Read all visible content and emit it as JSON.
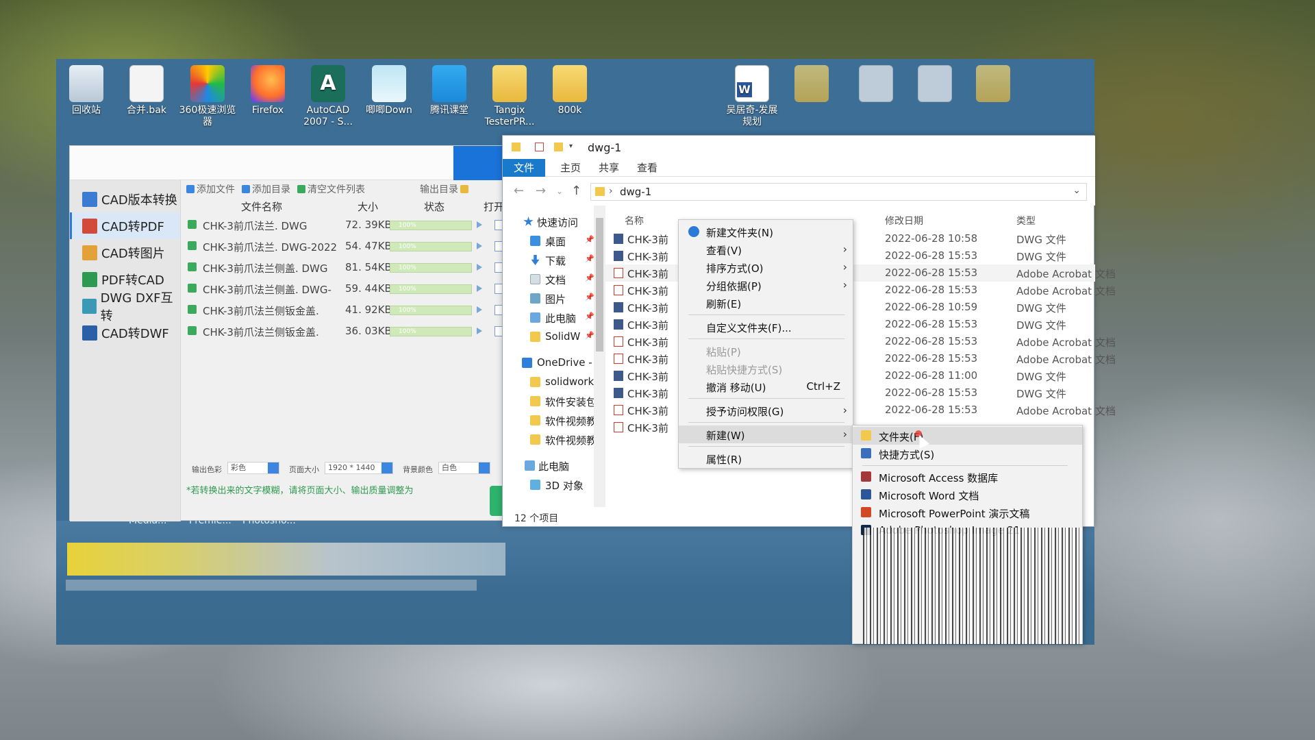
{
  "colors": {
    "desktop_blue": "#3d6e96",
    "explorer_file_tab": "#1979ca",
    "cad_active_blue": "#2a7ad9",
    "warning_green": "#2e9a4f",
    "progress_green": "#cfe9b8"
  },
  "desktop": {
    "icons": [
      {
        "label": "回收站",
        "icon": "recycle-bin-icon"
      },
      {
        "label": "合并.bak",
        "icon": "file-icon"
      },
      {
        "label": "360极速浏览器",
        "icon": "browser-360-icon"
      },
      {
        "label": "Firefox",
        "icon": "firefox-icon"
      },
      {
        "label": "AutoCAD 2007 - S...",
        "icon": "autocad-icon"
      },
      {
        "label": "唧唧Down",
        "icon": "jijidown-icon"
      },
      {
        "label": "腾讯课堂",
        "icon": "tencent-classroom-icon"
      },
      {
        "label": "Tangix TesterPR...",
        "icon": "folder-icon"
      },
      {
        "label": "800k",
        "icon": "folder-icon"
      },
      {
        "label": "吴居奇-发展规划",
        "icon": "word-document-icon"
      }
    ],
    "taskbar_fragments": [
      "Media...",
      "Premie...",
      "Photosho..."
    ]
  },
  "cad_app": {
    "sidebar": [
      {
        "label": "CAD版本转换",
        "active": false
      },
      {
        "label": "CAD转PDF",
        "active": true
      },
      {
        "label": "CAD转图片",
        "active": false
      },
      {
        "label": "PDF转CAD",
        "active": false
      },
      {
        "label": "DWG DXF互转",
        "active": false
      },
      {
        "label": "CAD转DWF",
        "active": false
      }
    ],
    "toolbar": {
      "add_file": "添加文件",
      "add_dir": "添加目录",
      "clear_list": "清空文件列表",
      "output_dir": "输出目录"
    },
    "columns": {
      "name": "文件名称",
      "size": "大小",
      "status": "状态",
      "open": "打开"
    },
    "rows": [
      {
        "name": "CHK-3前爪法兰. DWG",
        "size": "72. 39KB",
        "progress": "100%"
      },
      {
        "name": "CHK-3前爪法兰. DWG-2022",
        "size": "54. 47KB",
        "progress": "100%"
      },
      {
        "name": "CHK-3前爪法兰侧盖. DWG",
        "size": "81. 54KB",
        "progress": "100%"
      },
      {
        "name": "CHK-3前爪法兰侧盖. DWG-",
        "size": "59. 44KB",
        "progress": "100%"
      },
      {
        "name": "CHK-3前爪法兰侧钣金盖.",
        "size": "41. 92KB",
        "progress": "100%"
      },
      {
        "name": "CHK-3前爪法兰侧钣金盖.",
        "size": "36. 03KB",
        "progress": "100%"
      }
    ],
    "options": {
      "color_label": "输出色彩",
      "color_value": "彩色",
      "page_label": "页面大小",
      "page_value": "1920 * 1440",
      "bg_label": "背景颜色",
      "bg_value": "白色"
    },
    "warning": "*若转换出来的文字模糊，请将页面大小、输出质量调整为"
  },
  "explorer": {
    "title": "dwg-1",
    "tabs": [
      "文件",
      "主页",
      "共享",
      "查看"
    ],
    "address": "dwg-1",
    "nav": [
      {
        "label": "快速访问",
        "icon": "star-icon",
        "pinned": false
      },
      {
        "label": "桌面",
        "icon": "desktop-icon",
        "pinned": true
      },
      {
        "label": "下载",
        "icon": "download-icon",
        "pinned": true
      },
      {
        "label": "文档",
        "icon": "documents-icon",
        "pinned": true
      },
      {
        "label": "图片",
        "icon": "pictures-icon",
        "pinned": true
      },
      {
        "label": "此电脑",
        "icon": "computer-icon",
        "pinned": true
      },
      {
        "label": "SolidW",
        "icon": "folder-icon",
        "pinned": true
      },
      {
        "label": "OneDrive -",
        "icon": "cloud-icon",
        "pinned": false
      },
      {
        "label": "solidworks",
        "icon": "folder-icon",
        "pinned": false
      },
      {
        "label": "软件安装包",
        "icon": "folder-icon",
        "pinned": false
      },
      {
        "label": "软件视频教",
        "icon": "folder-icon",
        "pinned": false
      },
      {
        "label": "软件视频教",
        "icon": "folder-icon",
        "pinned": false
      },
      {
        "label": "此电脑",
        "icon": "computer-icon",
        "pinned": false
      },
      {
        "label": "3D 对象",
        "icon": "objects-3d-icon",
        "pinned": false
      }
    ],
    "columns": {
      "name": "名称",
      "date": "修改日期",
      "type": "类型"
    },
    "files": [
      {
        "name": "CHK-3前",
        "date": "2022-06-28 10:58",
        "type": "DWG 文件",
        "kind": "dwg"
      },
      {
        "name": "CHK-3前",
        "date": "2022-06-28 15:53",
        "type": "DWG 文件",
        "kind": "dwg"
      },
      {
        "name": "CHK-3前",
        "date": "2022-06-28 15:53",
        "type": "Adobe Acrobat 文档",
        "kind": "pdf"
      },
      {
        "name": "CHK-3前",
        "date": "2022-06-28 15:53",
        "type": "Adobe Acrobat 文档",
        "kind": "pdf"
      },
      {
        "name": "CHK-3前",
        "date": "2022-06-28 10:59",
        "type": "DWG 文件",
        "kind": "dwg"
      },
      {
        "name": "CHK-3前",
        "date": "2022-06-28 15:53",
        "type": "DWG 文件",
        "kind": "dwg"
      },
      {
        "name": "CHK-3前",
        "date": "2022-06-28 15:53",
        "type": "Adobe Acrobat 文档",
        "kind": "pdf"
      },
      {
        "name": "CHK-3前",
        "date": "2022-06-28 15:53",
        "type": "Adobe Acrobat 文档",
        "kind": "pdf"
      },
      {
        "name": "CHK-3前",
        "date": "2022-06-28 11:00",
        "type": "DWG 文件",
        "kind": "dwg"
      },
      {
        "name": "CHK-3前",
        "date": "2022-06-28 15:53",
        "type": "DWG 文件",
        "kind": "dwg"
      },
      {
        "name": "CHK-3前",
        "date": "2022-06-28 15:53",
        "type": "Adobe Acrobat 文档",
        "kind": "pdf"
      },
      {
        "name": "CHK-3前",
        "date": "",
        "type": "",
        "kind": "pdf"
      }
    ],
    "status": "12 个项目"
  },
  "context_menu": {
    "items": [
      {
        "label": "新建文件夹(N)",
        "submenu": false,
        "disabled": false,
        "shortcut": ""
      },
      {
        "label": "查看(V)",
        "submenu": true,
        "disabled": false,
        "shortcut": ""
      },
      {
        "label": "排序方式(O)",
        "submenu": true,
        "disabled": false,
        "shortcut": ""
      },
      {
        "label": "分组依据(P)",
        "submenu": true,
        "disabled": false,
        "shortcut": ""
      },
      {
        "label": "刷新(E)",
        "submenu": false,
        "disabled": false,
        "shortcut": ""
      },
      {
        "label": "自定义文件夹(F)...",
        "submenu": false,
        "disabled": false,
        "shortcut": ""
      },
      {
        "label": "粘贴(P)",
        "submenu": false,
        "disabled": true,
        "shortcut": ""
      },
      {
        "label": "粘贴快捷方式(S)",
        "submenu": false,
        "disabled": true,
        "shortcut": ""
      },
      {
        "label": "撤消 移动(U)",
        "submenu": false,
        "disabled": false,
        "shortcut": "Ctrl+Z"
      },
      {
        "label": "授予访问权限(G)",
        "submenu": true,
        "disabled": false,
        "shortcut": ""
      },
      {
        "label": "新建(W)",
        "submenu": true,
        "disabled": false,
        "shortcut": ""
      },
      {
        "label": "属性(R)",
        "submenu": false,
        "disabled": false,
        "shortcut": ""
      }
    ]
  },
  "new_submenu": {
    "items": [
      {
        "label": "文件夹(F)",
        "icon": "folder-icon"
      },
      {
        "label": "快捷方式(S)",
        "icon": "shortcut-icon"
      },
      {
        "label": "Microsoft Access 数据库",
        "icon": "access-icon"
      },
      {
        "label": "Microsoft Word 文档",
        "icon": "word-icon"
      },
      {
        "label": "Microsoft PowerPoint 演示文稿",
        "icon": "powerpoint-icon"
      },
      {
        "label": "Adobe Photoshop Image 21",
        "icon": "photoshop-icon"
      }
    ]
  }
}
